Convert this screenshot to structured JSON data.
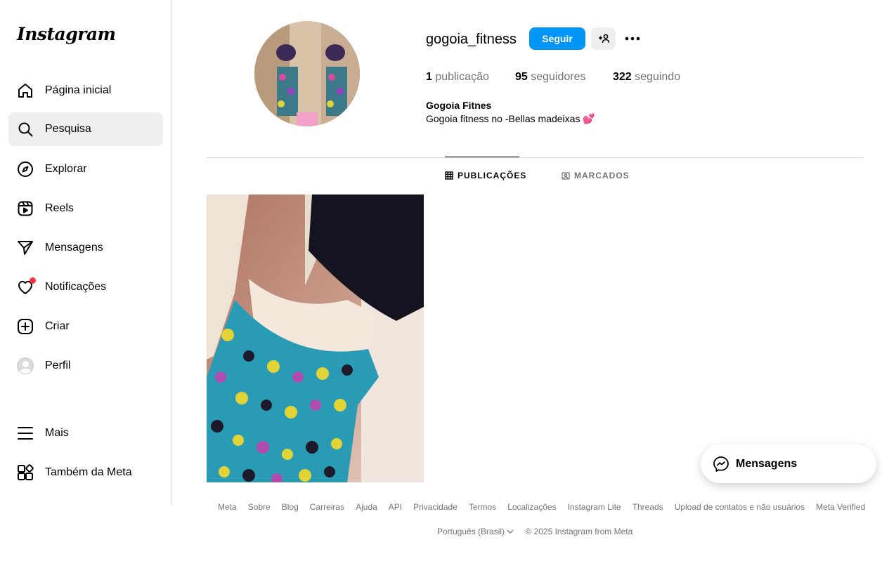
{
  "app": {
    "logo": "Instagram"
  },
  "sidebar": {
    "items": [
      {
        "label": "Página inicial",
        "icon": "home-icon"
      },
      {
        "label": "Pesquisa",
        "icon": "search-icon",
        "active": true
      },
      {
        "label": "Explorar",
        "icon": "compass-icon"
      },
      {
        "label": "Reels",
        "icon": "reels-icon"
      },
      {
        "label": "Mensagens",
        "icon": "send-icon"
      },
      {
        "label": "Notificações",
        "icon": "heart-icon",
        "badge": true
      },
      {
        "label": "Criar",
        "icon": "plus-square-icon"
      },
      {
        "label": "Perfil",
        "icon": "avatar"
      }
    ],
    "more": {
      "label": "Mais",
      "icon": "menu-icon"
    },
    "meta": {
      "label": "Também da Meta",
      "icon": "apps-icon"
    }
  },
  "profile": {
    "username": "gogoia_fitness",
    "follow_label": "Seguir",
    "suggest_label": "+👤",
    "more_label": "•••",
    "stats": {
      "posts_count": "1",
      "posts_label": "publicação",
      "followers_count": "95",
      "followers_label": "seguidores",
      "following_count": "322",
      "following_label": "seguindo"
    },
    "bio_name": "Gogoia Fitnes",
    "bio_text": "Gogoia fitness no -Bellas madeixas 💕"
  },
  "tabs": [
    {
      "label": "PUBLICAÇÕES",
      "icon": "grid-icon",
      "active": true
    },
    {
      "label": "MARCADOS",
      "icon": "tag-icon",
      "active": false
    }
  ],
  "footer": {
    "links": [
      "Meta",
      "Sobre",
      "Blog",
      "Carreiras",
      "Ajuda",
      "API",
      "Privacidade",
      "Termos",
      "Localizações",
      "Instagram Lite",
      "Threads",
      "Upload de contatos e não usuários",
      "Meta Verified"
    ],
    "language": "Português (Brasil)",
    "copyright": "© 2025 Instagram from Meta"
  },
  "messages_bubble": {
    "label": "Mensagens",
    "icon": "messenger-icon"
  },
  "colors": {
    "accent": "#0095f6",
    "notif": "#ff3040",
    "muted": "#737373",
    "border": "#dbdbdb"
  }
}
